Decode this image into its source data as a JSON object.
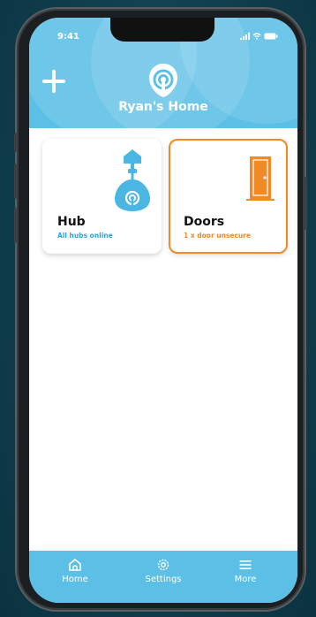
{
  "status_bar": {
    "time": "9:41"
  },
  "header": {
    "title": "Ryan's Home"
  },
  "cards": [
    {
      "title": "Hub",
      "status": "All hubs online",
      "status_color": "#27a8d8",
      "icon": "hub-icon"
    },
    {
      "title": "Doors",
      "status": "1 x door unsecure",
      "status_color": "#ef8a24",
      "icon": "door-icon"
    }
  ],
  "tabs": [
    {
      "label": "Home",
      "icon": "home-icon"
    },
    {
      "label": "Settings",
      "icon": "gear-icon"
    },
    {
      "label": "More",
      "icon": "menu-icon"
    }
  ],
  "colors": {
    "accent": "#5bbfe6",
    "warning": "#ef8a24",
    "hub_blue": "#4cb6e2"
  }
}
